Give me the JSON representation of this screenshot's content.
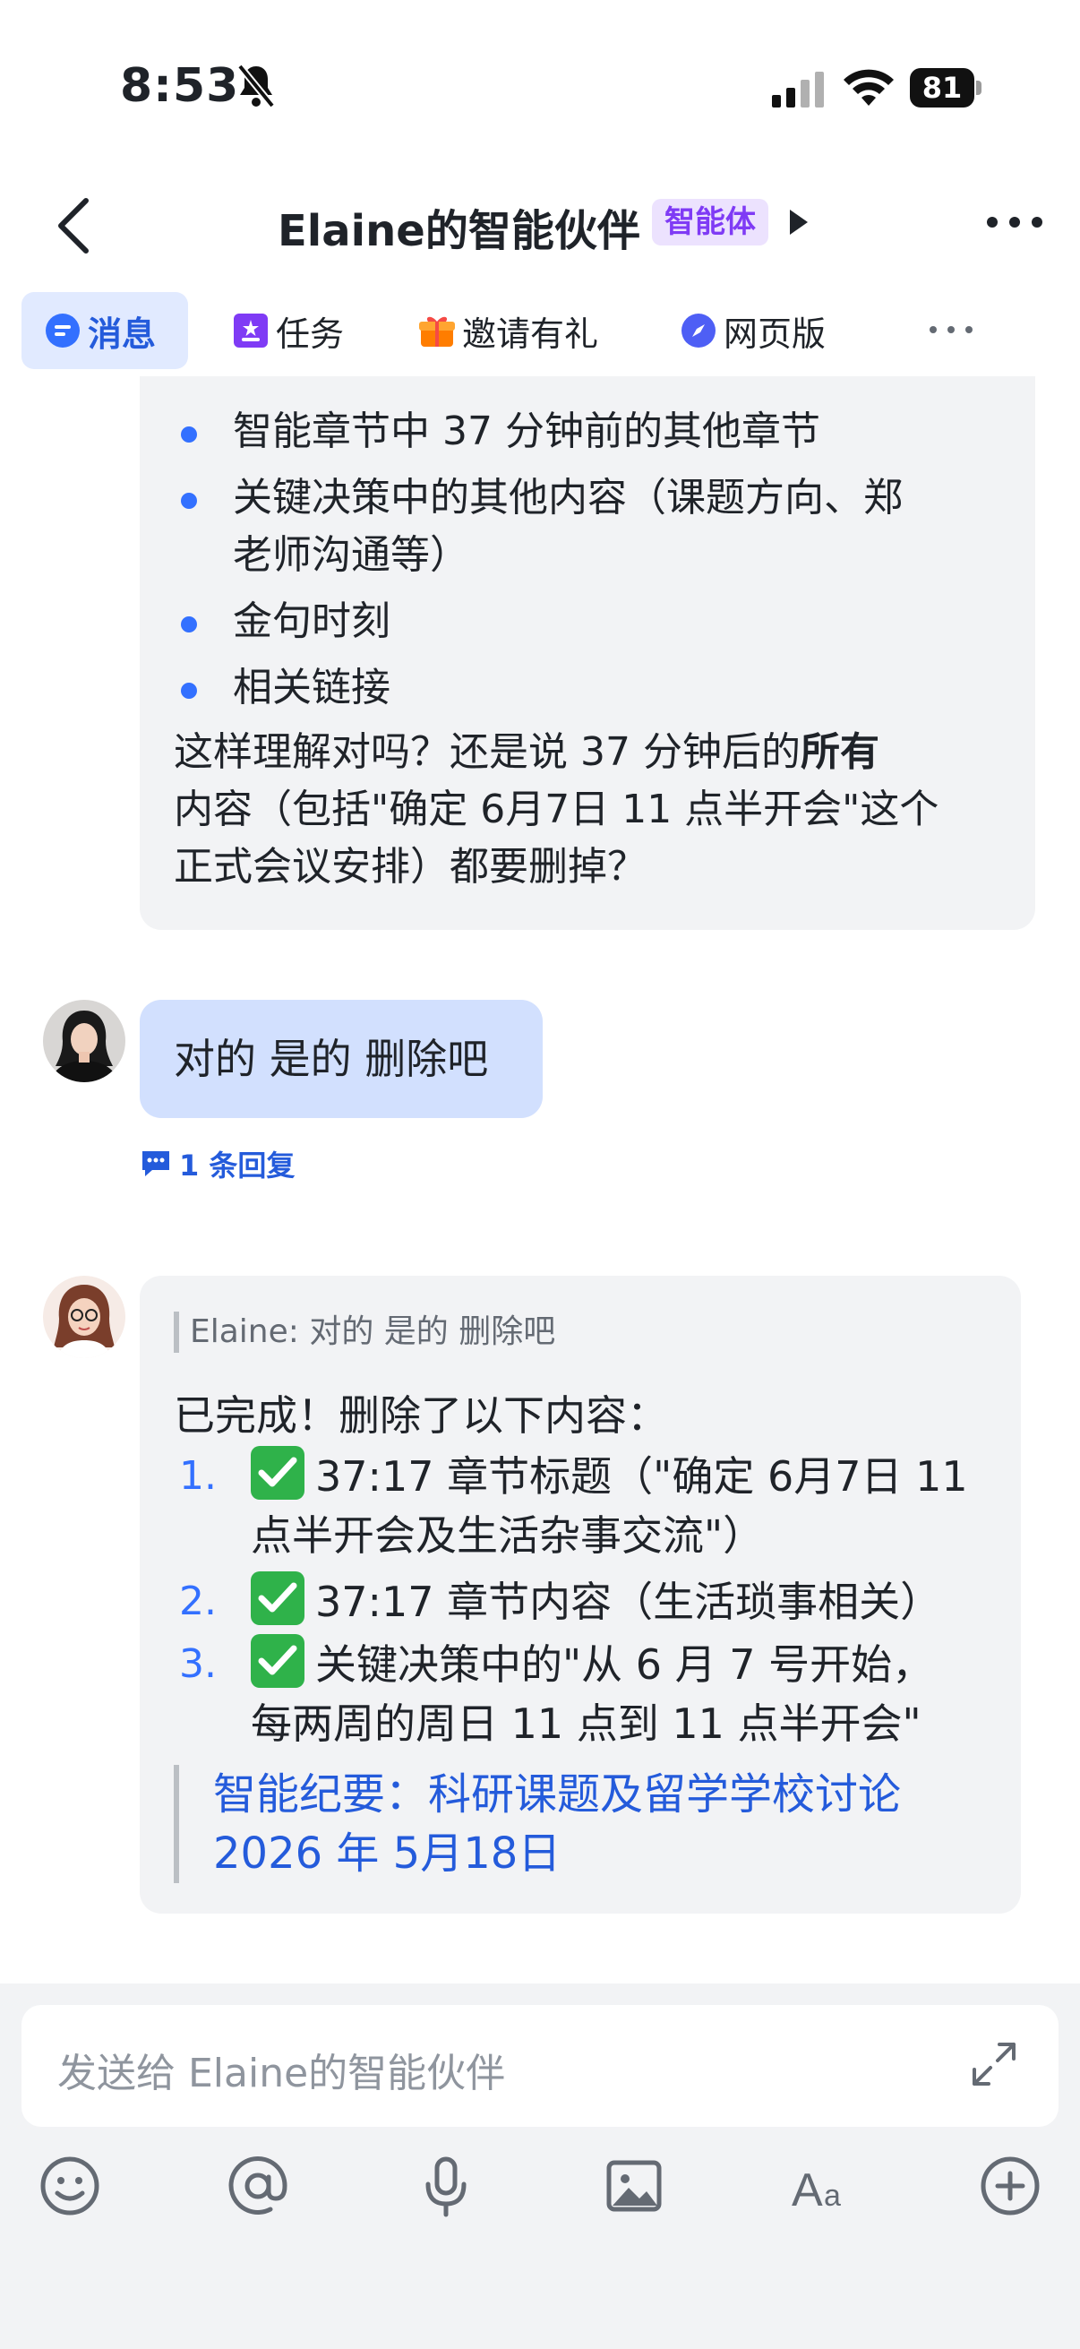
{
  "status_bar": {
    "time": "8:53",
    "battery": "81"
  },
  "header": {
    "title": "Elaine的智能伙伴",
    "badge": "智能体"
  },
  "tabs": [
    {
      "label": "消息"
    },
    {
      "label": "任务"
    },
    {
      "label": "邀请有礼"
    },
    {
      "label": "网页版"
    }
  ],
  "prev_message": {
    "bullets": [
      "智能章节中 37 分钟前的其他章节",
      "关键决策中的其他内容（课题方向、郑",
      "老师沟通等）",
      "金句时刻",
      "相关链接"
    ],
    "question_line1_a": "这样理解对吗？还是说 37 分钟后的",
    "question_line1_b": "所有",
    "question_line2": "内容（包括\"确定 6月7日 11 点半开会\"这个",
    "question_line3": "正式会议安排）都要删掉？"
  },
  "user_message": {
    "text": "对的 是的 删除吧",
    "reply_count": "1 条回复"
  },
  "bot_message": {
    "quote": "Elaine: 对的 是的 删除吧",
    "intro": "已完成！删除了以下内容：",
    "items": [
      {
        "num": "1.",
        "line1": "37:17 章节标题（\"确定 6月7日 11",
        "line2": "点半开会及生活杂事交流\"）"
      },
      {
        "num": "2.",
        "line1": "37:17 章节内容（生活琐事相关）"
      },
      {
        "num": "3.",
        "line1": "关键决策中的\"从 6 月 7 号开始，",
        "line2": "每两周的周日 11 点到 11 点半开会\""
      }
    ],
    "link_line1": "智能纪要：科研课题及留学学校讨论",
    "link_line2": "2026 年 5月18日"
  },
  "composer": {
    "placeholder": "发送给 Elaine的智能伙伴"
  },
  "colors": {
    "accent": "#3370ff",
    "badge_bg": "#ece2fe",
    "badge_text": "#7f3bf5",
    "user_bubble": "#d2e0fe",
    "bubble": "#f2f3f5"
  },
  "icons": [
    "bell-muted-icon",
    "cellular-icon",
    "wifi-icon",
    "back-icon",
    "play-icon",
    "more-icon",
    "message-icon",
    "task-icon",
    "gift-icon",
    "compass-icon",
    "reply-icon",
    "check-icon",
    "expand-icon",
    "emoji-icon",
    "mention-icon",
    "microphone-icon",
    "image-icon",
    "text-format-icon",
    "add-icon"
  ]
}
